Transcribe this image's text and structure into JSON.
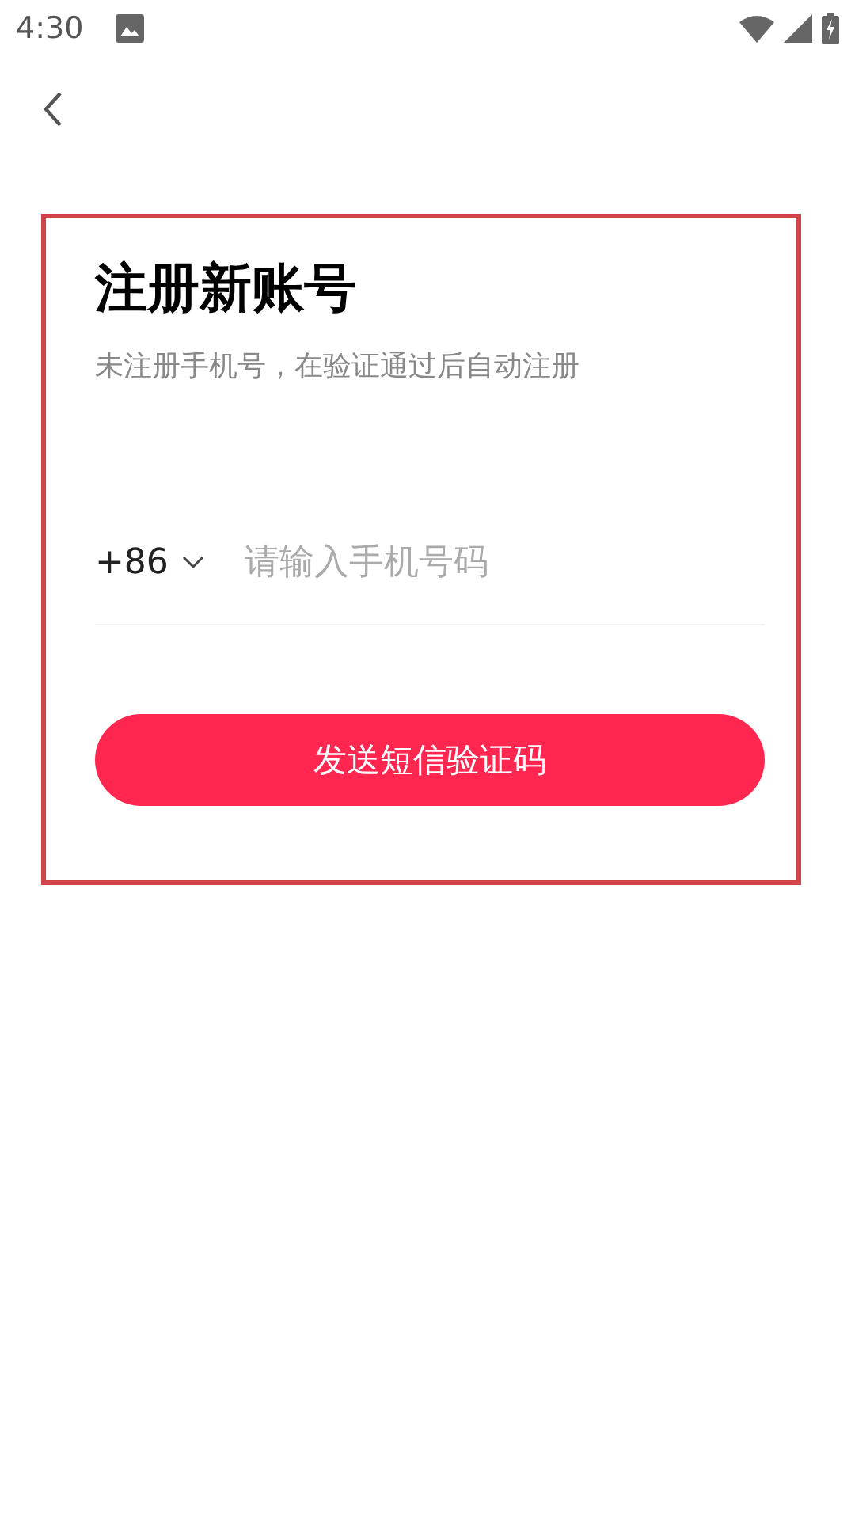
{
  "status_bar": {
    "time": "4:30"
  },
  "form": {
    "title": "注册新账号",
    "subtitle": "未注册手机号，在验证通过后自动注册",
    "country_code": "+86",
    "phone_placeholder": "请输入手机号码",
    "submit_button": "发送短信验证码"
  }
}
